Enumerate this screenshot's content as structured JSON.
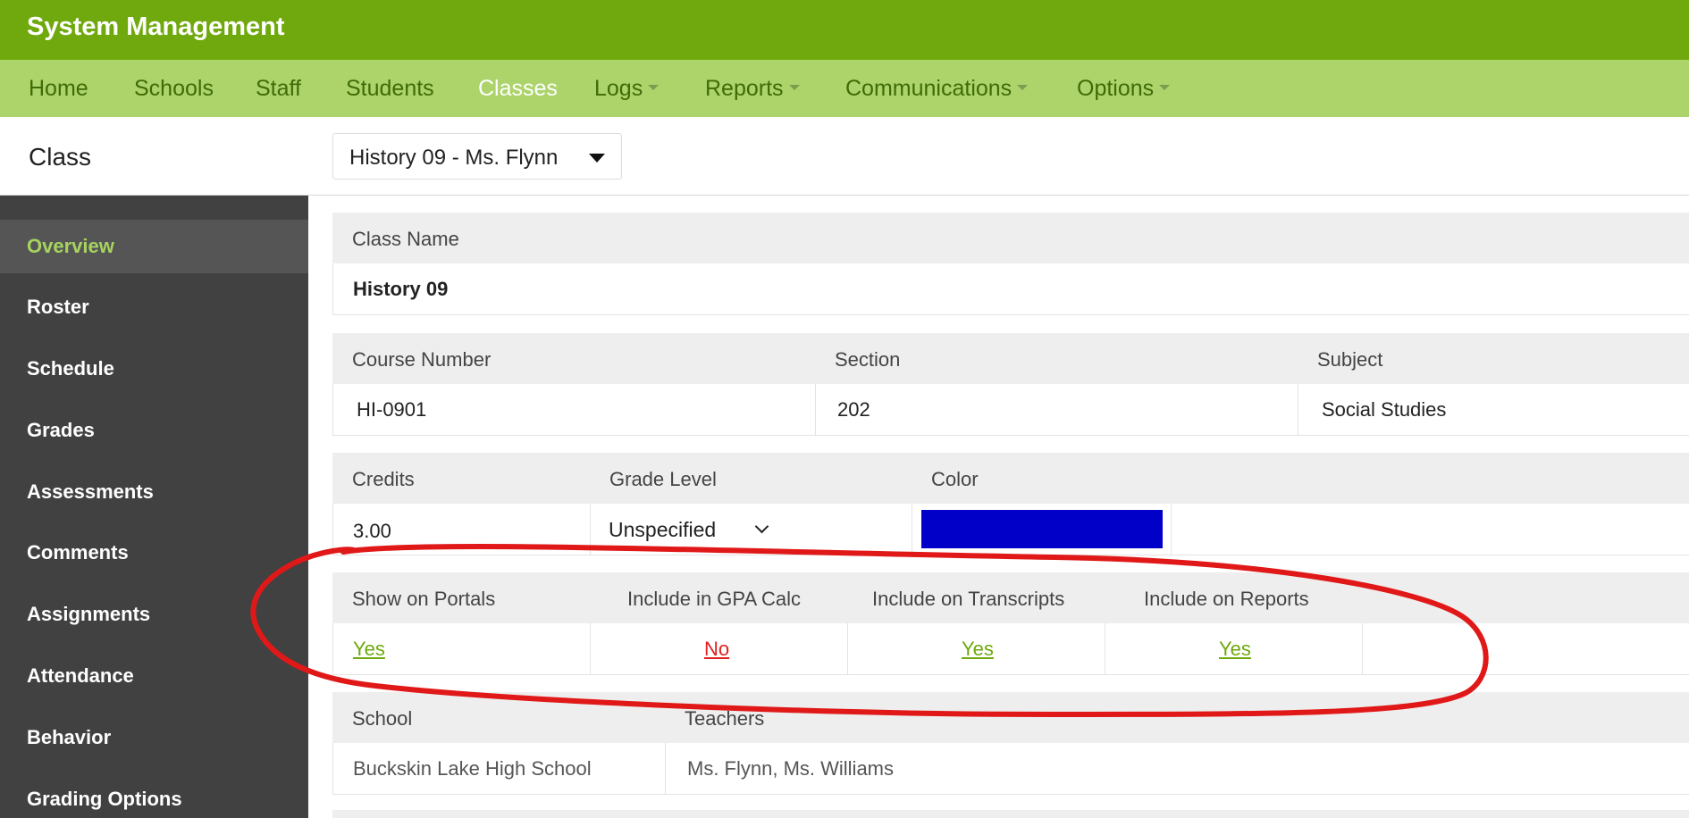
{
  "app": {
    "title": "System Management"
  },
  "nav": [
    {
      "label": "Home",
      "active": false,
      "dropdown": false
    },
    {
      "label": "Schools",
      "active": false,
      "dropdown": false
    },
    {
      "label": "Staff",
      "active": false,
      "dropdown": false
    },
    {
      "label": "Students",
      "active": false,
      "dropdown": false
    },
    {
      "label": "Classes",
      "active": true,
      "dropdown": false
    },
    {
      "label": "Logs",
      "active": false,
      "dropdown": true
    },
    {
      "label": "Reports",
      "active": false,
      "dropdown": true
    },
    {
      "label": "Communications",
      "active": false,
      "dropdown": true
    },
    {
      "label": "Options",
      "active": false,
      "dropdown": true
    }
  ],
  "subheader": {
    "title": "Class",
    "class_select": {
      "selected": "History 09 - Ms. Flynn",
      "icon": "caret-down-icon"
    }
  },
  "sidebar": {
    "items": [
      {
        "label": "Overview",
        "active": true
      },
      {
        "label": "Roster",
        "active": false
      },
      {
        "label": "Schedule",
        "active": false
      },
      {
        "label": "Grades",
        "active": false
      },
      {
        "label": "Assessments",
        "active": false
      },
      {
        "label": "Comments",
        "active": false
      },
      {
        "label": "Assignments",
        "active": false
      },
      {
        "label": "Attendance",
        "active": false
      },
      {
        "label": "Behavior",
        "active": false
      },
      {
        "label": "Grading Options",
        "active": false
      }
    ]
  },
  "details": {
    "class_name": {
      "label": "Class Name",
      "value": "History 09"
    },
    "course": {
      "course_number_label": "Course Number",
      "course_number": "HI-0901",
      "section_label": "Section",
      "section": "202",
      "subject_label": "Subject",
      "subject": "Social Studies"
    },
    "credits_row": {
      "credits_label": "Credits",
      "credits": "3.00",
      "grade_level_label": "Grade Level",
      "grade_level": "Unspecified",
      "color_label": "Color",
      "color": "#0000c8"
    },
    "flags": {
      "show_on_portals_label": "Show on Portals",
      "show_on_portals": "Yes",
      "include_gpa_label": "Include in GPA Calc",
      "include_gpa": "No",
      "include_transcripts_label": "Include on Transcripts",
      "include_transcripts": "Yes",
      "include_reports_label": "Include on Reports",
      "include_reports": "Yes"
    },
    "school_row": {
      "school_label": "School",
      "school": "Buckskin Lake High School",
      "teachers_label": "Teachers",
      "teachers": "Ms. Flynn,  Ms. Williams"
    }
  },
  "colors": {
    "brand_green": "#6fa90d",
    "nav_light_green": "#acd46a",
    "sidebar_bg": "#414141",
    "link_yes": "#6fa90d",
    "link_no": "#e12020",
    "annotation_red": "#e01818"
  }
}
